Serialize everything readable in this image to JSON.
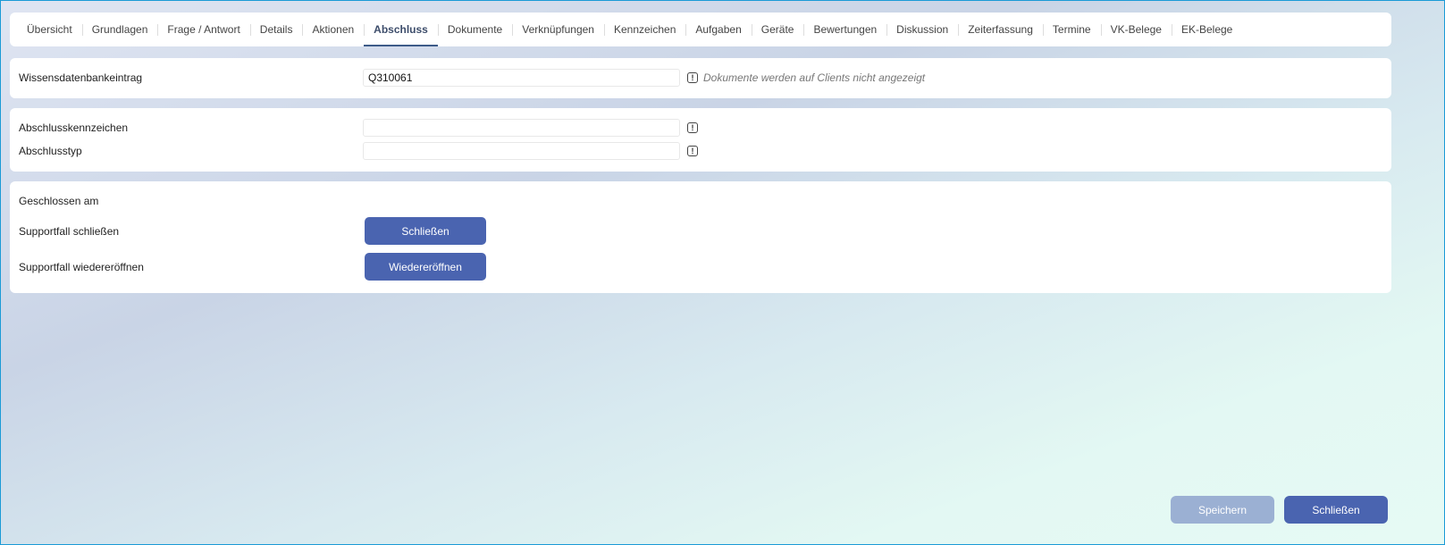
{
  "tabs": [
    "Übersicht",
    "Grundlagen",
    "Frage / Antwort",
    "Details",
    "Aktionen",
    "Abschluss",
    "Dokumente",
    "Verknüpfungen",
    "Kennzeichen",
    "Aufgaben",
    "Geräte",
    "Bewertungen",
    "Diskussion",
    "Zeiterfassung",
    "Termine",
    "VK-Belege",
    "EK-Belege"
  ],
  "active_tab": "Abschluss",
  "knowledge": {
    "label": "Wissensdatenbankeintrag",
    "value": "Q310061",
    "hint": "Dokumente werden auf Clients nicht angezeigt"
  },
  "closure": {
    "code_label": "Abschlusskennzeichen",
    "code_value": "",
    "type_label": "Abschlusstyp",
    "type_value": ""
  },
  "status": {
    "closed_on_label": "Geschlossen am",
    "close_label": "Supportfall schließen",
    "close_button": "Schließen",
    "reopen_label": "Supportfall wiedereröffnen",
    "reopen_button": "Wiedereröffnen"
  },
  "footer": {
    "save": "Speichern",
    "close": "Schließen"
  },
  "colors": {
    "primary": "#4a64b0",
    "disabled": "#9bb0d3"
  }
}
